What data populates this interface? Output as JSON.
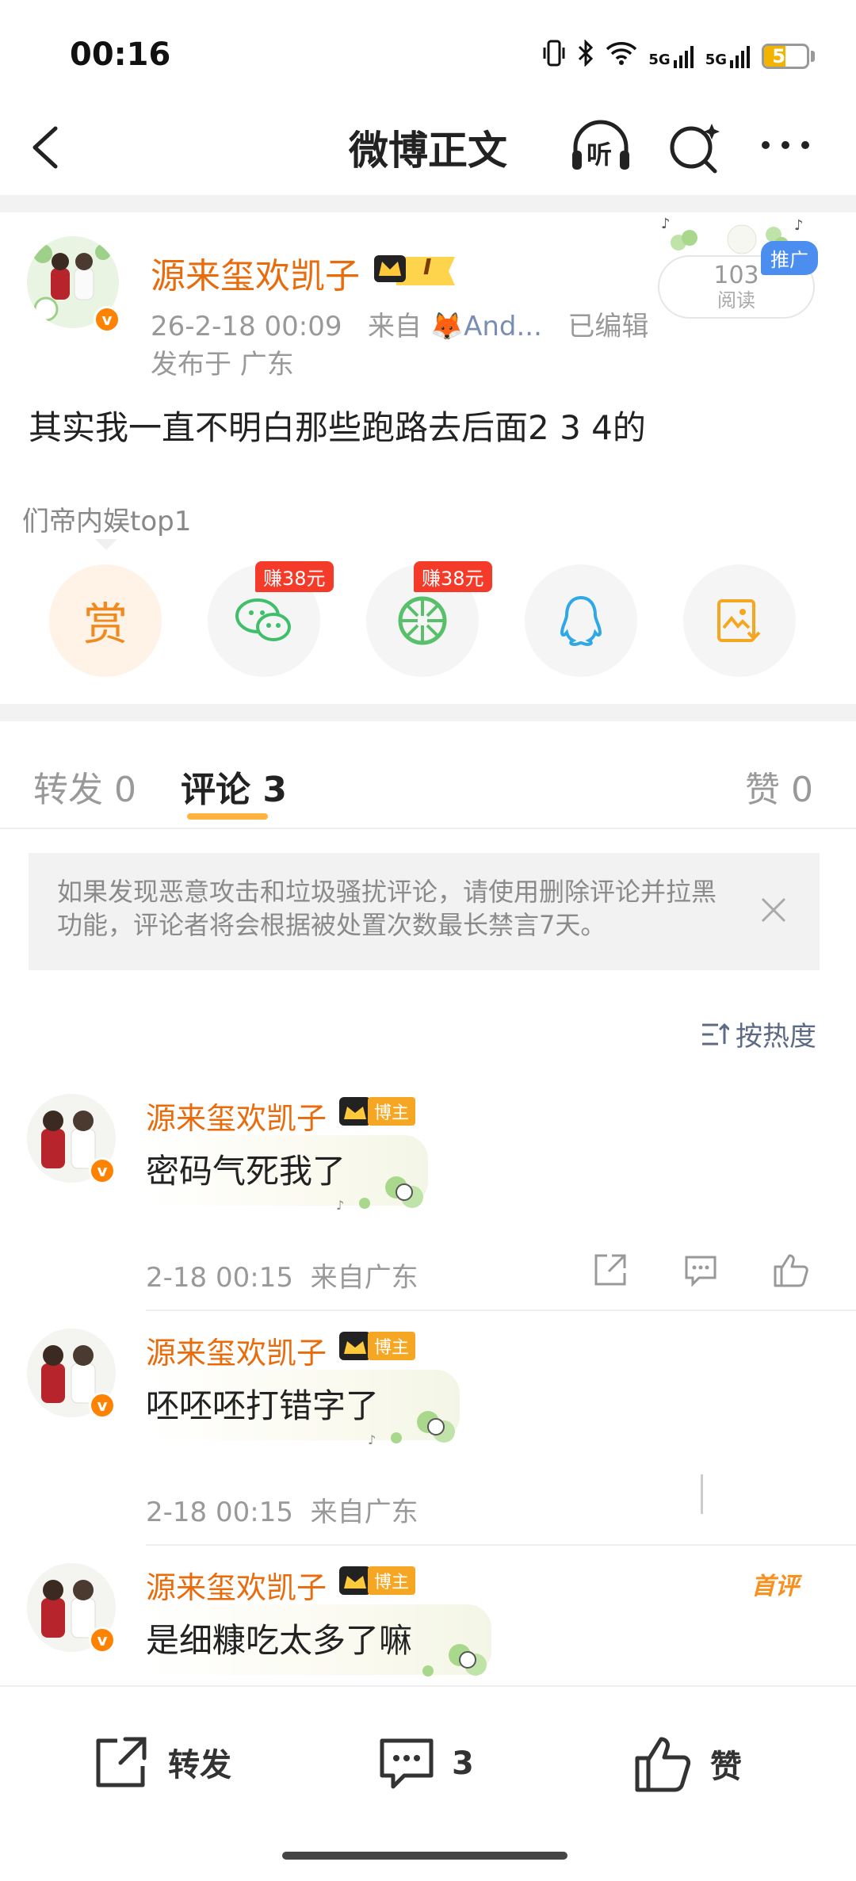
{
  "status_bar": {
    "time": "00:16",
    "network_1": "5G",
    "network_2": "5G",
    "battery": "50",
    "battery_level": 0.5
  },
  "nav": {
    "title": "微博正文",
    "listen_label": "听"
  },
  "post": {
    "author": "源来玺欢凯子",
    "level_badge": "I",
    "timestamp": "26-2-18 00:09",
    "source_prefix": "来自",
    "source": "And...",
    "edited": "已编辑",
    "location": "发布于 广东",
    "read_count": "103",
    "read_label": "阅读",
    "promo_tag": "推广",
    "text": "其实我一直不明白那些跑路去后面2 3 4的",
    "tagline": "们帝内娱top1"
  },
  "share": {
    "reward_label": "赏",
    "wechat_earn": "赚38元",
    "moments_earn": "赚38元"
  },
  "tabs": [
    {
      "label": "转发 0"
    },
    {
      "label": "评论 3"
    },
    {
      "label": "赞 0"
    }
  ],
  "notice": {
    "text": "如果发现恶意攻击和垃圾骚扰评论，请使用删除评论并拉黑功能，评论者将会根据被处置次数最长禁言7天。"
  },
  "sort": {
    "label": "按热度"
  },
  "comments": [
    {
      "author": "源来玺欢凯子",
      "tag": "博主",
      "text": "密码气死我了",
      "time": "2-18 00:15",
      "location": "来自广东"
    },
    {
      "author": "源来玺欢凯子",
      "tag": "博主",
      "text": "呸呸呸打错字了",
      "time": "2-18 00:15",
      "location": "来自广东"
    },
    {
      "author": "源来玺欢凯子",
      "tag": "博主",
      "text": "是细糠吃太多了嘛",
      "first_tag": "首评"
    }
  ],
  "bottom_bar": {
    "repost_label": "转发",
    "comment_count": "3",
    "like_label": "赞"
  },
  "colors": {
    "accent_orange": "#e86b0c",
    "tab_underline": "#ffb23f",
    "earn_red": "#f43b2a",
    "verify_orange": "#ff8200"
  }
}
